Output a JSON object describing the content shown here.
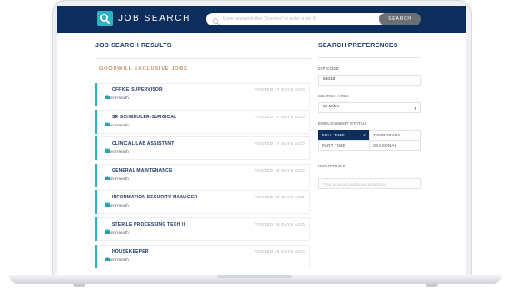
{
  "header": {
    "logo_text": "JOB SEARCH",
    "search_placeholder": "Enter keywords like \"plumber\" or enter a job ID",
    "search_button": "SEARCH"
  },
  "results": {
    "title": "JOB SEARCH RESULTS",
    "section_label": "GOODWILL EXCLUSIVE JOBS",
    "jobs": [
      {
        "title": "OFFICE SUPERVISOR",
        "company": "HonorHealth",
        "posted": "POSTED 17 DAYS AGO"
      },
      {
        "title": "SR SCHEDULER-SURGICAL",
        "company": "HonorHealth",
        "posted": "POSTED 17 DAYS AGO"
      },
      {
        "title": "CLINICAL LAB ASSISTANT",
        "company": "HonorHealth",
        "posted": "POSTED 17 DAYS AGO"
      },
      {
        "title": "GENERAL MAINTENANCE",
        "company": "HonorHealth",
        "posted": "POSTED 18 DAYS AGO"
      },
      {
        "title": "INFORMATION SECURITY MANAGER",
        "company": "HonorHealth",
        "posted": "POSTED 18 DAYS AGO"
      },
      {
        "title": "STERILE PROCESSING TECH II",
        "company": "HonorHealth",
        "posted": "POSTED 18 DAYS AGO"
      },
      {
        "title": "HOUSEKEEPER",
        "company": "HonorHealth",
        "posted": "POSTED 19 DAYS AGO"
      }
    ]
  },
  "preferences": {
    "title": "SEARCH PREFERENCES",
    "zip_label": "ZIP CODE",
    "zip_value": "85018",
    "area_label": "SEARCH AREA",
    "area_value": "25 Miles",
    "employment_label": "EMPLOYMENT STATUS",
    "employment_options": [
      {
        "label": "FULL TIME",
        "selected": true
      },
      {
        "label": "TEMPORARY",
        "selected": false
      },
      {
        "label": "PART TIME",
        "selected": false
      },
      {
        "label": "SEASONAL",
        "selected": false
      }
    ],
    "industries_label": "INDUSTRIES",
    "industries_placeholder": "Type to search additional industries"
  },
  "colors": {
    "header_bg": "#0d2d5c",
    "accent": "#2bb3c0",
    "section_label": "#a1632e",
    "search_button": "#6b6e73"
  }
}
